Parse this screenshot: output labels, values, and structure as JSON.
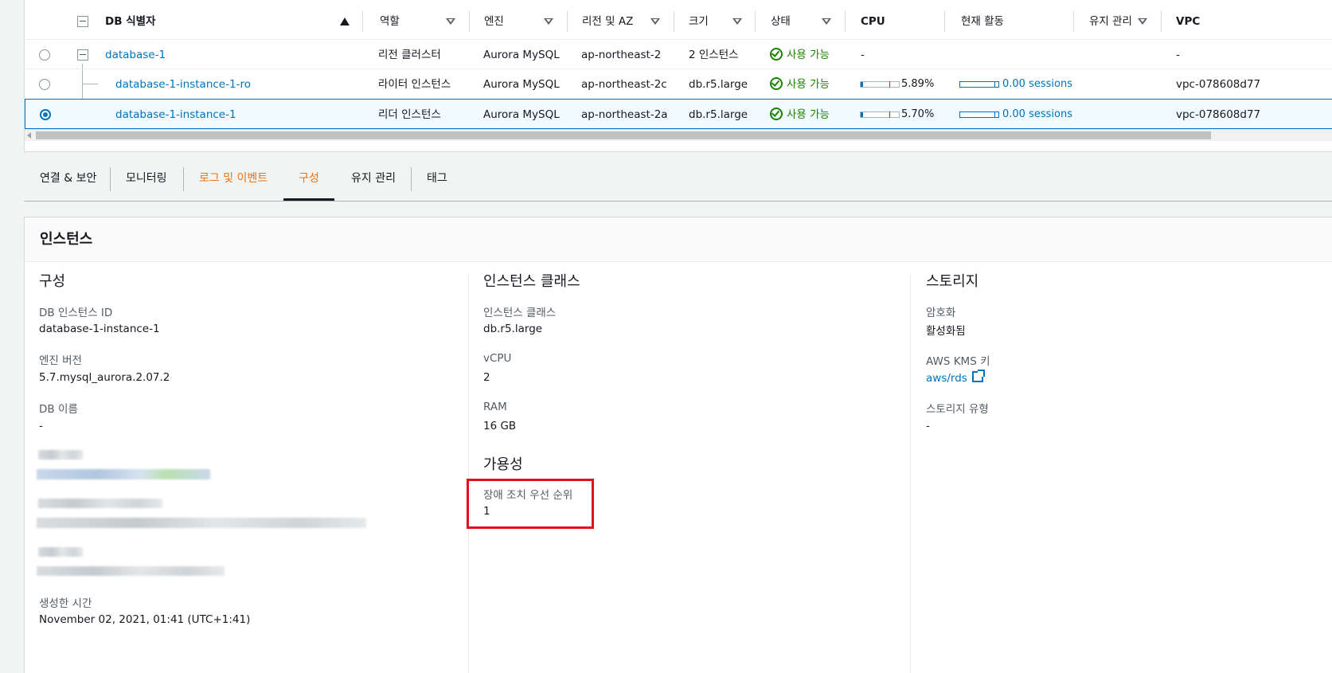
{
  "table": {
    "headers": {
      "db_id": "DB 식별자",
      "role": "역할",
      "engine": "엔진",
      "region_az": "리전 및 AZ",
      "size": "크기",
      "status": "상태",
      "cpu": "CPU",
      "activity": "현재 활동",
      "maintenance": "유지 관리",
      "vpc": "VPC"
    },
    "rows": [
      {
        "db_id": "database-1",
        "role": "리전 클러스터",
        "engine": "Aurora MySQL",
        "region_az": "ap-northeast-2",
        "size": "2 인스턴스",
        "status": "사용 가능",
        "cpu": "-",
        "activity": "",
        "vpc": "-"
      },
      {
        "db_id": "database-1-instance-1-ro",
        "role": "라이터 인스턴스",
        "engine": "Aurora MySQL",
        "region_az": "ap-northeast-2c",
        "size": "db.r5.large",
        "status": "사용 가능",
        "cpu": "5.89%",
        "cpu_fraction": 0.0589,
        "activity": "0.00 sessions",
        "vpc": "vpc-078608d77"
      },
      {
        "db_id": "database-1-instance-1",
        "role": "리더 인스턴스",
        "engine": "Aurora MySQL",
        "region_az": "ap-northeast-2a",
        "size": "db.r5.large",
        "status": "사용 가능",
        "cpu": "5.70%",
        "cpu_fraction": 0.057,
        "activity": "0.00 sessions",
        "vpc": "vpc-078608d77"
      }
    ]
  },
  "tabs": [
    "연결 & 보안",
    "모니터링",
    "로그 및 이벤트",
    "구성",
    "유지 관리",
    "태그"
  ],
  "active_tab": "구성",
  "detail": {
    "title": "인스턴스",
    "config": {
      "heading": "구성",
      "instance_id_label": "DB 인스턴스 ID",
      "instance_id": "database-1-instance-1",
      "engine_version_label": "엔진 버전",
      "engine_version": "5.7.mysql_aurora.2.07.2",
      "db_name_label": "DB 이름",
      "db_name": "-",
      "created_label": "생성한 시간",
      "created": "November 02, 2021, 01:41 (UTC+1:41)"
    },
    "instance_class": {
      "heading": "인스턴스 클래스",
      "class_label": "인스턴스 클래스",
      "class": "db.r5.large",
      "vcpu_label": "vCPU",
      "vcpu": "2",
      "ram_label": "RAM",
      "ram": "16 GB"
    },
    "availability": {
      "heading": "가용성",
      "failover_label": "장애 조치 우선 순위",
      "failover": "1"
    },
    "storage": {
      "heading": "스토리지",
      "encryption_label": "암호화",
      "encryption": "활성화됨",
      "kms_label": "AWS KMS 키",
      "kms": "aws/rds",
      "storage_type_label": "스토리지 유형",
      "storage_type": "-"
    }
  },
  "colors": {
    "link": "#0073bb",
    "status_ok": "#1d8102",
    "active_tab": "#ec7211",
    "highlight": "#e0101e"
  }
}
